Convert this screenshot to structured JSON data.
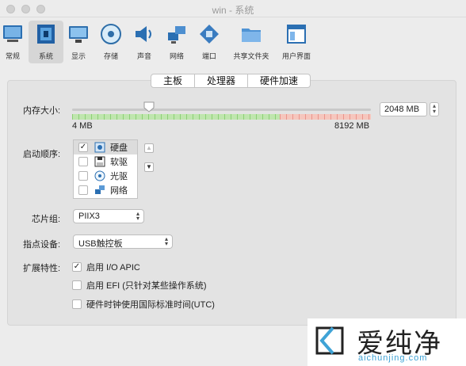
{
  "window": {
    "title": "win - 系统"
  },
  "toolbar": {
    "items": [
      {
        "label": "常规"
      },
      {
        "label": "系统",
        "selected": true
      },
      {
        "label": "显示"
      },
      {
        "label": "存储"
      },
      {
        "label": "声音"
      },
      {
        "label": "网络"
      },
      {
        "label": "端口"
      },
      {
        "label": "共享文件夹"
      },
      {
        "label": "用户界面"
      }
    ]
  },
  "tabs": [
    {
      "label": "主板",
      "selected": true
    },
    {
      "label": "处理器"
    },
    {
      "label": "硬件加速"
    }
  ],
  "memory": {
    "label": "内存大小:",
    "value": "2048 MB",
    "min_label": "4 MB",
    "max_label": "8192 MB",
    "slider_fraction": 0.25
  },
  "boot_order": {
    "label": "启动顺序:",
    "items": [
      {
        "label": "硬盘",
        "checked": true,
        "icon": "hard-disk-icon"
      },
      {
        "label": "软驱",
        "checked": false,
        "icon": "floppy-icon"
      },
      {
        "label": "光驱",
        "checked": false,
        "icon": "optical-drive-icon"
      },
      {
        "label": "网络",
        "checked": false,
        "icon": "network-icon"
      }
    ]
  },
  "chipset": {
    "label": "芯片组:",
    "value": "PIIX3"
  },
  "pointing_device": {
    "label": "指点设备:",
    "value": "USB触控板"
  },
  "extended": {
    "label": "扩展特性:",
    "options": [
      {
        "label": "启用 I/O APIC",
        "checked": true
      },
      {
        "label": "启用 EFI (只针对某些操作系统)",
        "checked": false
      },
      {
        "label": "硬件时钟使用国际标准时间(UTC)",
        "checked": false
      }
    ]
  },
  "watermark": {
    "text": "爱纯净",
    "url": "aichunjing.com"
  },
  "colors": {
    "slider_ok": "#8ccf76",
    "slider_warn": "#e9958c",
    "accent": "#3fa3d6"
  }
}
